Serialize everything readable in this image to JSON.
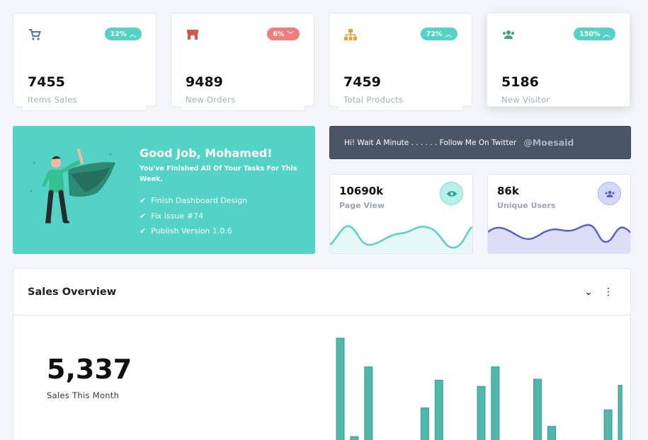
{
  "stats": [
    {
      "value": "7455",
      "label": "Items Sales",
      "badge": "12%",
      "trend": "up",
      "badge_color": "#52d3c6",
      "icon": "cart-icon",
      "icon_color": "#5b68c7"
    },
    {
      "value": "9489",
      "label": "New Orders",
      "badge": "6%",
      "trend": "down",
      "badge_color": "#f27c7c",
      "icon": "store-icon",
      "icon_color": "#d9534f"
    },
    {
      "value": "7459",
      "label": "Total Products",
      "badge": "72%",
      "trend": "up",
      "badge_color": "#52d3c6",
      "icon": "hierarchy-icon",
      "icon_color": "#e0a23a"
    },
    {
      "value": "5186",
      "label": "New Visitor",
      "badge": "150%",
      "trend": "up",
      "badge_color": "#52d3c6",
      "icon": "users-icon",
      "icon_color": "#3aa876"
    }
  ],
  "hero": {
    "title": "Good Job, Mohamed!",
    "subtitle": "You've Finished All Of Your Tasks For This Week.",
    "tasks": [
      "Finish Dashboard Design",
      "Fix Issue #74",
      "Publish Version 1.0.6"
    ]
  },
  "tweet": {
    "message": "Hi! Wait A Minute . . . . . . Follow Me On Twitter",
    "handle": "@Moesaid"
  },
  "page_view": {
    "value": "10690k",
    "label": "Page View",
    "color": "#52d3c6"
  },
  "unique_users": {
    "value": "86k",
    "label": "Unique Users",
    "color": "#5a5fd1"
  },
  "sales_overview": {
    "title": "Sales Overview",
    "value": "5,337",
    "label": "Sales This Month",
    "bar_color": "#4fb8aa",
    "bar_values": [
      100,
      4,
      72,
      0,
      0,
      0,
      32,
      59,
      0,
      0,
      53,
      72,
      0,
      0,
      60,
      14,
      0,
      0,
      0,
      30,
      54
    ]
  }
}
